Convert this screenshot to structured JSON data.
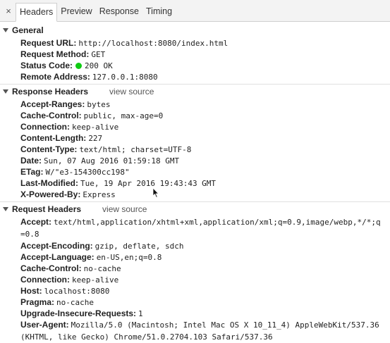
{
  "tabs": {
    "close_glyph": "×",
    "items": [
      "Headers",
      "Preview",
      "Response",
      "Timing"
    ]
  },
  "view_source_label": "view source",
  "general": {
    "title": "General",
    "request_url_key": "Request URL:",
    "request_url": "http://localhost:8080/index.html",
    "request_method_key": "Request Method:",
    "request_method": "GET",
    "status_code_key": "Status Code:",
    "status_code": "200 OK",
    "status_color": "#0ecb12",
    "remote_address_key": "Remote Address:",
    "remote_address": "127.0.0.1:8080"
  },
  "response_headers": {
    "title": "Response Headers",
    "rows": [
      {
        "key": "Accept-Ranges:",
        "value": "bytes"
      },
      {
        "key": "Cache-Control:",
        "value": "public, max-age=0"
      },
      {
        "key": "Connection:",
        "value": "keep-alive"
      },
      {
        "key": "Content-Length:",
        "value": "227"
      },
      {
        "key": "Content-Type:",
        "value": "text/html; charset=UTF-8"
      },
      {
        "key": "Date:",
        "value": "Sun, 07 Aug 2016 01:59:18 GMT"
      },
      {
        "key": "ETag:",
        "value": "W/\"e3-154300cc198\""
      },
      {
        "key": "Last-Modified:",
        "value": "Tue, 19 Apr 2016 19:43:43 GMT"
      },
      {
        "key": "X-Powered-By:",
        "value": "Express"
      }
    ]
  },
  "request_headers": {
    "title": "Request Headers",
    "rows": [
      {
        "key": "Accept:",
        "value": "text/html,application/xhtml+xml,application/xml;q=0.9,image/webp,*/*;q=0.8"
      },
      {
        "key": "Accept-Encoding:",
        "value": "gzip, deflate, sdch"
      },
      {
        "key": "Accept-Language:",
        "value": "en-US,en;q=0.8"
      },
      {
        "key": "Cache-Control:",
        "value": "no-cache"
      },
      {
        "key": "Connection:",
        "value": "keep-alive"
      },
      {
        "key": "Host:",
        "value": "localhost:8080"
      },
      {
        "key": "Pragma:",
        "value": "no-cache"
      },
      {
        "key": "Upgrade-Insecure-Requests:",
        "value": "1"
      },
      {
        "key": "User-Agent:",
        "value": "Mozilla/5.0 (Macintosh; Intel Mac OS X 10_11_4) AppleWebKit/537.36 (KHTML, like Gecko) Chrome/51.0.2704.103 Safari/537.36"
      }
    ]
  }
}
